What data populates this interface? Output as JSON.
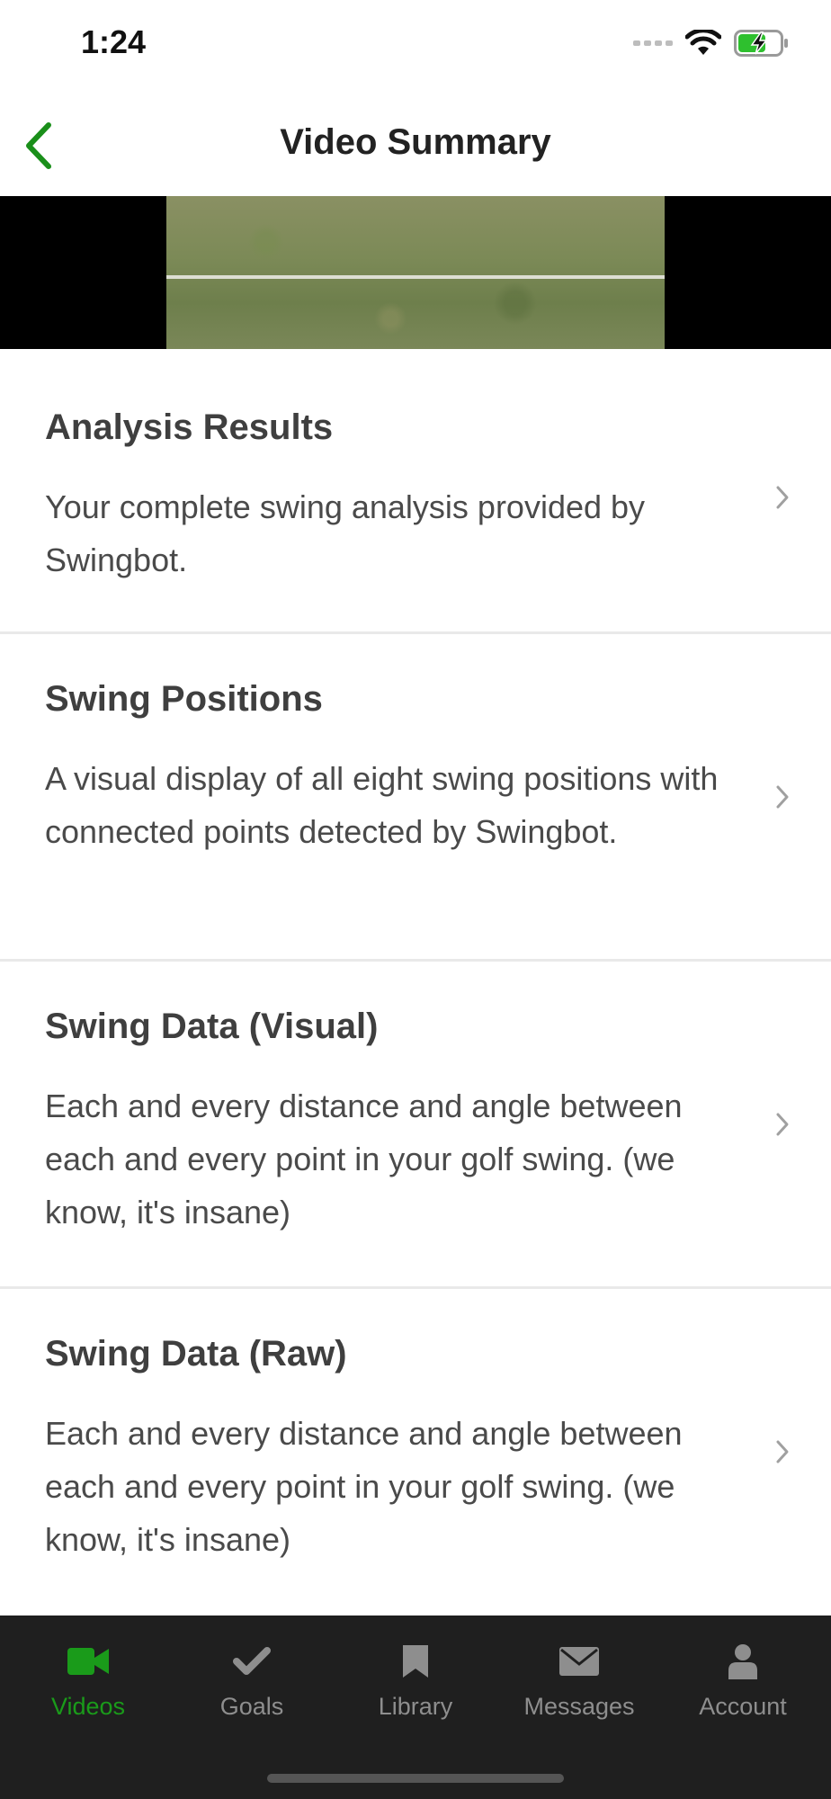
{
  "status_bar": {
    "time": "1:24"
  },
  "nav": {
    "title": "Video Summary",
    "back_icon": "chevron-left-icon"
  },
  "colors": {
    "accent": "#1a8f1a",
    "tab_bar_bg": "#1f1f1f",
    "tab_inactive": "#8e8e8e",
    "battery_fill": "#2ec02e"
  },
  "list": {
    "items": [
      {
        "title": "Analysis Results",
        "description": "Your complete swing analysis provided by Swingbot."
      },
      {
        "title": "Swing Positions",
        "description": "A visual display of all eight swing positions with connected points detected by Swingbot."
      },
      {
        "title": "Swing Data (Visual)",
        "description": "Each and every distance and angle between each and every point in your golf swing. (we know, it's insane)"
      },
      {
        "title": "Swing Data (Raw)",
        "description": "Each and every distance and angle between each and every point in your golf swing. (we know, it's insane)"
      }
    ]
  },
  "tabs": [
    {
      "label": "Videos",
      "icon": "video-camera-icon",
      "active": true
    },
    {
      "label": "Goals",
      "icon": "checkmark-icon",
      "active": false
    },
    {
      "label": "Library",
      "icon": "bookmark-icon",
      "active": false
    },
    {
      "label": "Messages",
      "icon": "envelope-icon",
      "active": false
    },
    {
      "label": "Account",
      "icon": "person-icon",
      "active": false
    }
  ]
}
